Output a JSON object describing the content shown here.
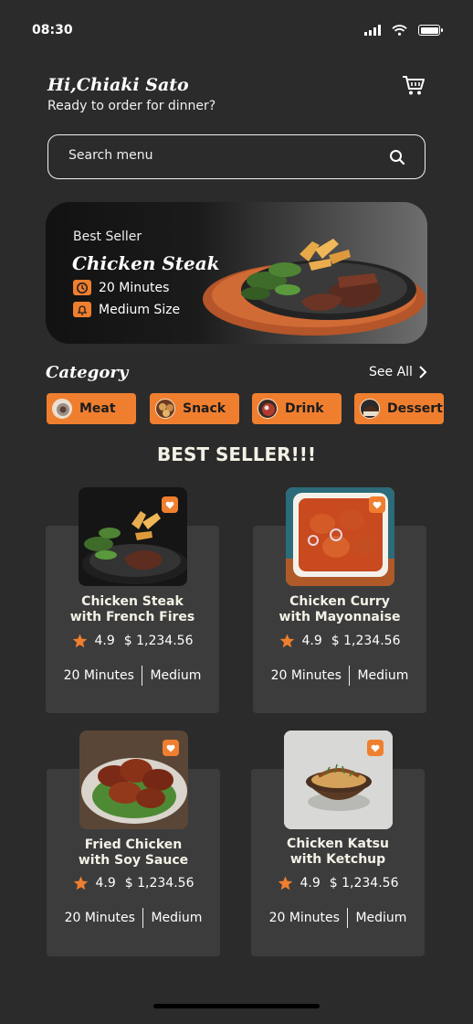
{
  "status": {
    "time": "08:30"
  },
  "header": {
    "greeting": "Hi,Chiaki Sato",
    "subtitle": "Ready to order for dinner?"
  },
  "search": {
    "placeholder": "Search menu"
  },
  "banner": {
    "label": "Best Seller",
    "title": "Chicken Steak",
    "duration": "20 Minutes",
    "size": "Medium Size"
  },
  "categories": {
    "title": "Category",
    "see_all": "See All",
    "items": [
      {
        "label": "Meat"
      },
      {
        "label": "Snack"
      },
      {
        "label": "Drink"
      },
      {
        "label": "Dessert"
      }
    ]
  },
  "best_seller": {
    "title": "BEST SELLER!!!",
    "items": [
      {
        "name_line1": "Chicken Steak",
        "name_line2": "with French Fires",
        "rating": "4.9",
        "price": "$ 1,234.56",
        "time": "20 Minutes",
        "size": "Medium"
      },
      {
        "name_line1": "Chicken Curry",
        "name_line2": "with Mayonnaise",
        "rating": "4.9",
        "price": "$ 1,234.56",
        "time": "20 Minutes",
        "size": "Medium"
      },
      {
        "name_line1": "Fried Chicken",
        "name_line2": "with Soy Sauce",
        "rating": "4.9",
        "price": "$ 1,234.56",
        "time": "20 Minutes",
        "size": "Medium"
      },
      {
        "name_line1": "Chicken Katsu",
        "name_line2": "with Ketchup",
        "rating": "4.9",
        "price": "$ 1,234.56",
        "time": "20 Minutes",
        "size": "Medium"
      }
    ]
  },
  "colors": {
    "accent": "#ef7f2f",
    "background": "#2b2b2b",
    "card": "#3c3c3c"
  }
}
